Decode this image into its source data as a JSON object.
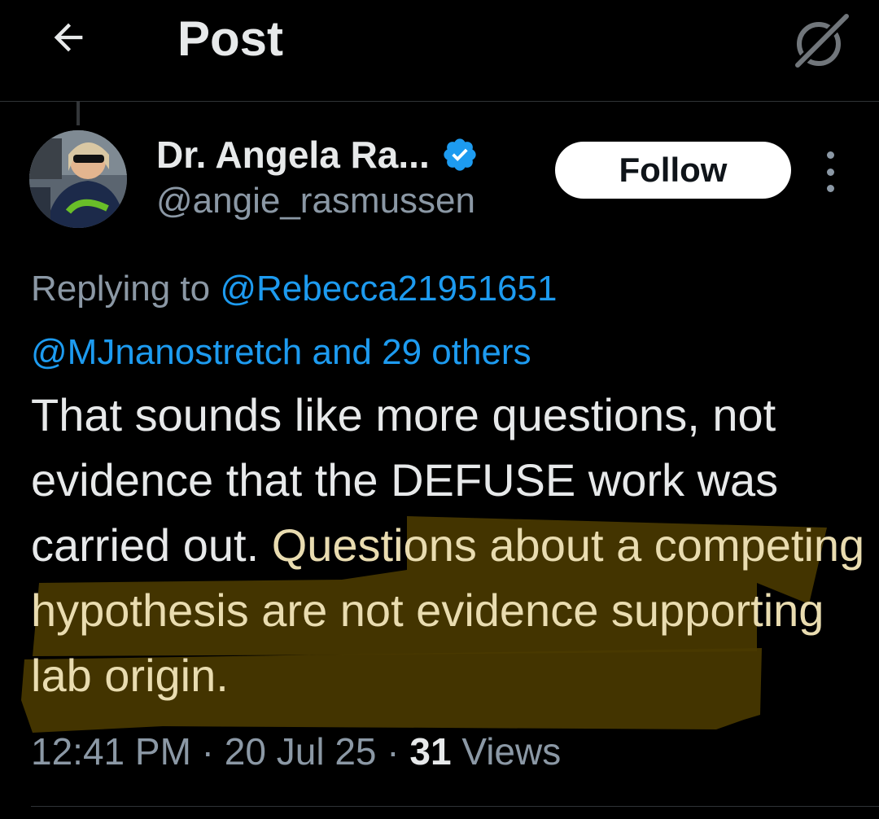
{
  "header": {
    "title": "Post",
    "back_icon": "arrow-left-icon",
    "grok_icon": "grok-icon"
  },
  "author": {
    "name": "Dr. Angela Ra...",
    "handle": "@angie_rasmussen",
    "verified": true,
    "verified_color": "#1d9bf0"
  },
  "follow_label": "Follow",
  "replying": {
    "prefix": "Replying to ",
    "user1": "@Rebecca21951651",
    "user2": "@MJnanostretch",
    "others": " and 29 others"
  },
  "post": {
    "text_plain": "That sounds like more questions, not evidence that the DEFUSE work was carried out. ",
    "text_highlighted": "Questions about a competing hypothesis are not evidence supporting  lab origin.",
    "highlight_color": "#7a6300"
  },
  "meta": {
    "time": "12:41 PM",
    "sep": " · ",
    "date": "20 Jul 25",
    "views_count": "31",
    "views_label": " Views"
  }
}
